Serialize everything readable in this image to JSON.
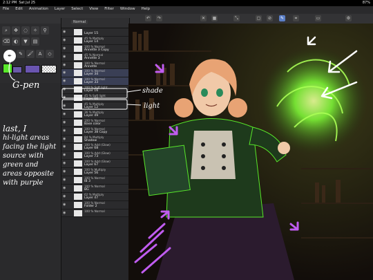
{
  "status": {
    "time": "2:12 PM",
    "date": "Sat Jul 25",
    "battery": "87%"
  },
  "menu": [
    "File",
    "Edit",
    "Animation",
    "Layer",
    "Select",
    "View",
    "Filter",
    "Window",
    "Help"
  ],
  "layer_panel": {
    "blend_mode": "Normal",
    "layers": [
      {
        "mode": "",
        "name": "Layer 15"
      },
      {
        "mode": "45 % Multiply",
        "name": "Layer 14"
      },
      {
        "mode": "100 % Normal",
        "name": "Annette 3 Copy"
      },
      {
        "mode": "45 % Normal",
        "name": "Annette 3"
      },
      {
        "mode": "100 % Normal",
        "name": "Annette"
      },
      {
        "mode": "100 % Normal",
        "name": "Layer 34"
      },
      {
        "mode": "100 % Normal",
        "name": "Layer 33"
      },
      {
        "mode": "100 % Soft light",
        "name": "Layer 16"
      },
      {
        "mode": "45 % Soft light",
        "name": "Layer 66"
      },
      {
        "mode": "45 % Multiply",
        "name": "Layer 12"
      },
      {
        "mode": "36 % Multiply",
        "name": "Layer 49"
      },
      {
        "mode": "100 % Normal",
        "name": "Base color"
      },
      {
        "mode": "100 % Normal",
        "name": "Layer 38 Copy"
      },
      {
        "mode": "84 % Multiply",
        "name": "Shadow"
      },
      {
        "mode": "100 % Add (Glow)",
        "name": "Layer 68"
      },
      {
        "mode": "100 % Add (Glow)",
        "name": "Layer 73"
      },
      {
        "mode": "100 % Add (Glow)",
        "name": "Layer 67"
      },
      {
        "mode": "100 % Multiply",
        "name": "Layer 56"
      },
      {
        "mode": "100 % Normal",
        "name": "IB 3"
      },
      {
        "mode": "100 % Normal",
        "name": "BG"
      },
      {
        "mode": "62 % Multiply",
        "name": "Layer 47"
      },
      {
        "mode": "100 % Normal",
        "name": "Folder 2"
      },
      {
        "mode": "100 % Normal",
        "name": ""
      }
    ]
  },
  "notes": {
    "gpen": "G-pen",
    "main": [
      "last, I",
      "hi-light areas",
      "facing the light",
      "source with",
      "green and",
      "areas opposite",
      "with purple"
    ],
    "shade": "shade",
    "light": "light"
  },
  "colors": {
    "green": "#58e82a",
    "purple": "#c05cf0",
    "accent": "#5b7fc7"
  }
}
